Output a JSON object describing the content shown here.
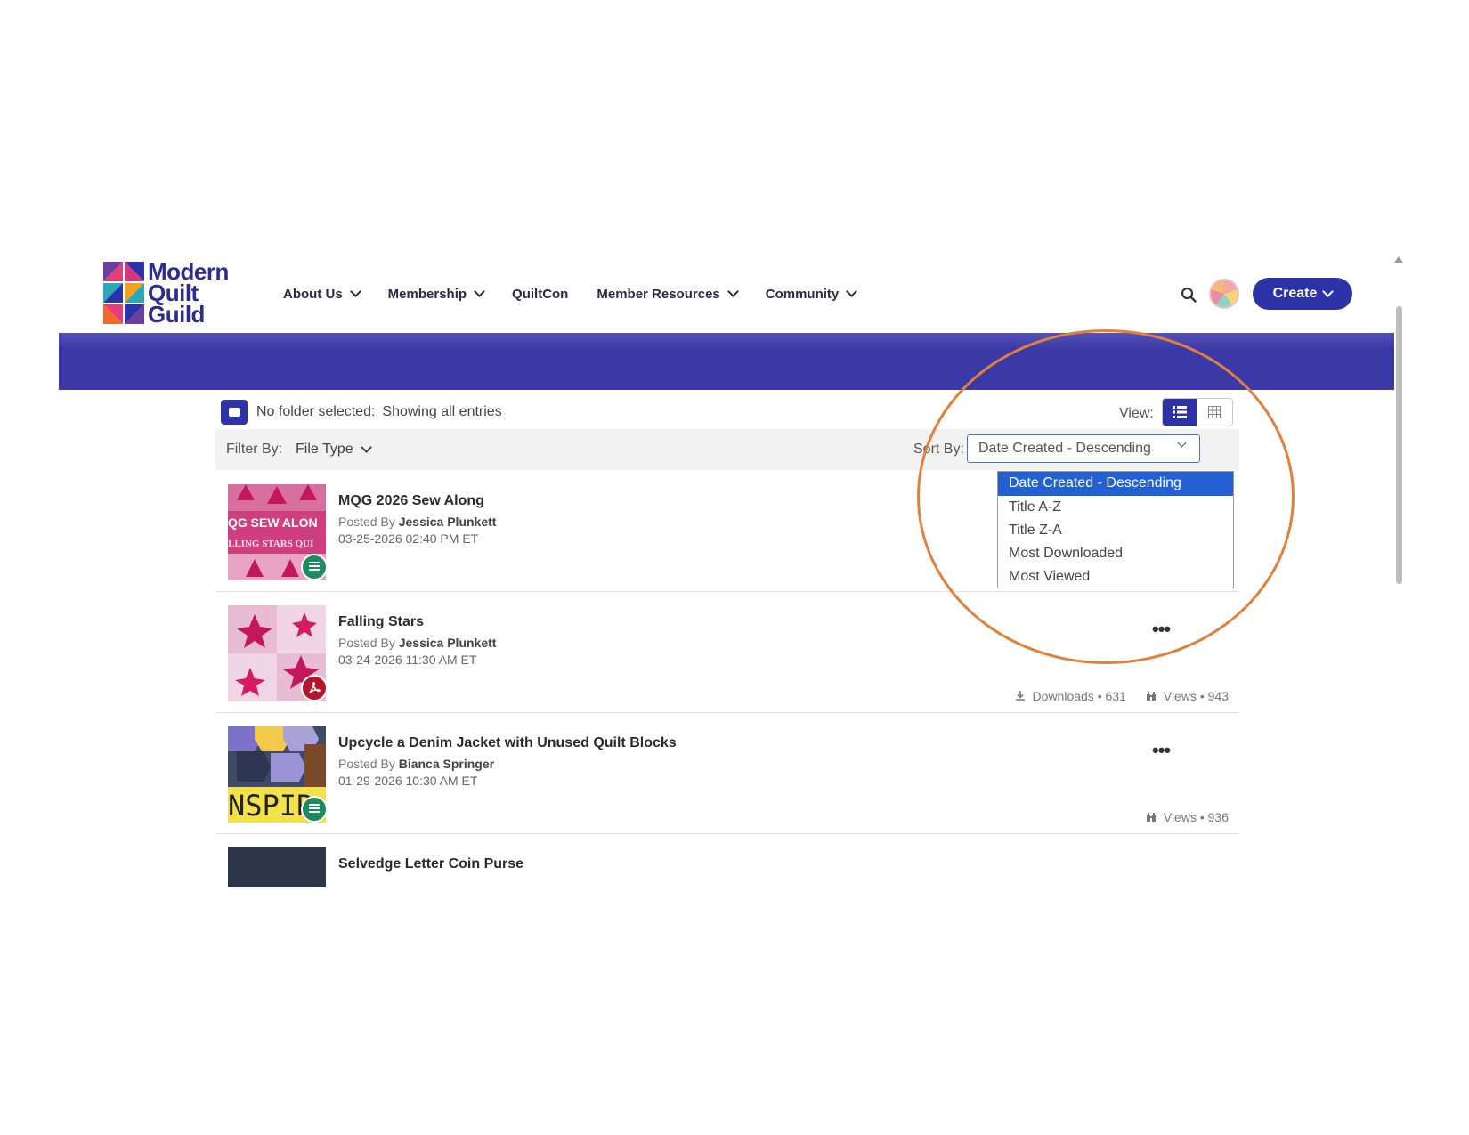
{
  "header": {
    "logo_lines": [
      "Modern",
      "Quilt",
      "Guild"
    ],
    "nav": [
      {
        "label": "About Us",
        "has_menu": true
      },
      {
        "label": "Membership",
        "has_menu": true
      },
      {
        "label": "QuiltCon",
        "has_menu": false
      },
      {
        "label": "Member Resources",
        "has_menu": true
      },
      {
        "label": "Community",
        "has_menu": true
      }
    ],
    "create_label": "Create"
  },
  "colors": {
    "brand": "#2c33a6",
    "banner": "#3b39a8",
    "highlight": "#2360d4",
    "annotation": "#e0803b"
  },
  "folder": {
    "label": "No folder selected:",
    "status": "Showing all entries"
  },
  "view": {
    "label": "View:",
    "active": "list"
  },
  "filter": {
    "label": "Filter By:",
    "value": "File Type"
  },
  "sort": {
    "label": "Sort By:",
    "selected": "Date Created - Descending",
    "options": [
      "Date Created - Descending",
      "Title A-Z",
      "Title Z-A",
      "Most Downloaded",
      "Most Viewed"
    ]
  },
  "entries": [
    {
      "title": "MQG 2026 Sew Along",
      "posted_prefix": "Posted By",
      "author": "Jessica Plunkett",
      "date": "03-25-2026 02:40 PM ET",
      "thumb_text": [
        "QG SEW ALON",
        "LLING STARS QUI"
      ],
      "file_icon": "doc-icon"
    },
    {
      "title": "Falling Stars",
      "posted_prefix": "Posted By",
      "author": "Jessica Plunkett",
      "date": "03-24-2026 11:30 AM ET",
      "file_icon": "pdf-icon",
      "downloads": "Downloads • 631",
      "views": "Views • 943"
    },
    {
      "title": "Upcycle a Denim Jacket with Unused Quilt Blocks",
      "posted_prefix": "Posted By",
      "author": "Bianca Springer",
      "date": "01-29-2026 10:30 AM ET",
      "thumb_text": [
        "NSPIR"
      ],
      "file_icon": "doc-icon",
      "views": "Views • 936"
    },
    {
      "title": "Selvedge Letter Coin Purse"
    }
  ]
}
